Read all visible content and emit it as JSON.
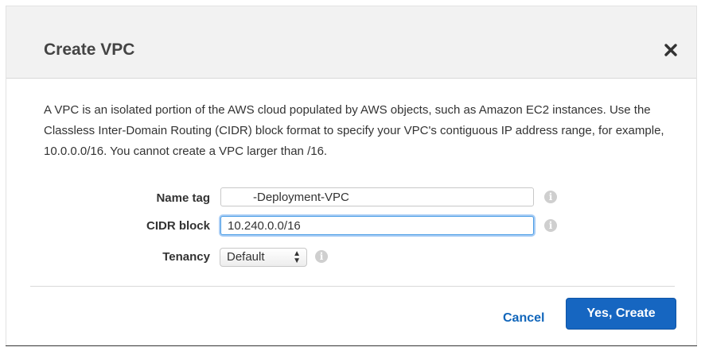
{
  "dialog": {
    "title": "Create VPC",
    "close_icon": "close-icon",
    "description": "A VPC is an isolated portion of the AWS cloud populated by AWS objects, such as Amazon EC2 instances. Use the Classless Inter-Domain Routing (CIDR) block format to specify your VPC's contiguous IP address range, for example, 10.0.0.0/16. You cannot create a VPC larger than /16."
  },
  "form": {
    "name_tag": {
      "label": "Name tag",
      "value": "-Deployment-VPC"
    },
    "cidr_block": {
      "label": "CIDR block",
      "value": "10.240.0.0/16"
    },
    "tenancy": {
      "label": "Tenancy",
      "selected": "Default"
    },
    "info_icon": "info-icon"
  },
  "actions": {
    "cancel_label": "Cancel",
    "create_label": "Yes, Create"
  },
  "colors": {
    "primary_button": "#1666c1",
    "link": "#1166bb",
    "focus_ring": "#4c9ee6"
  }
}
